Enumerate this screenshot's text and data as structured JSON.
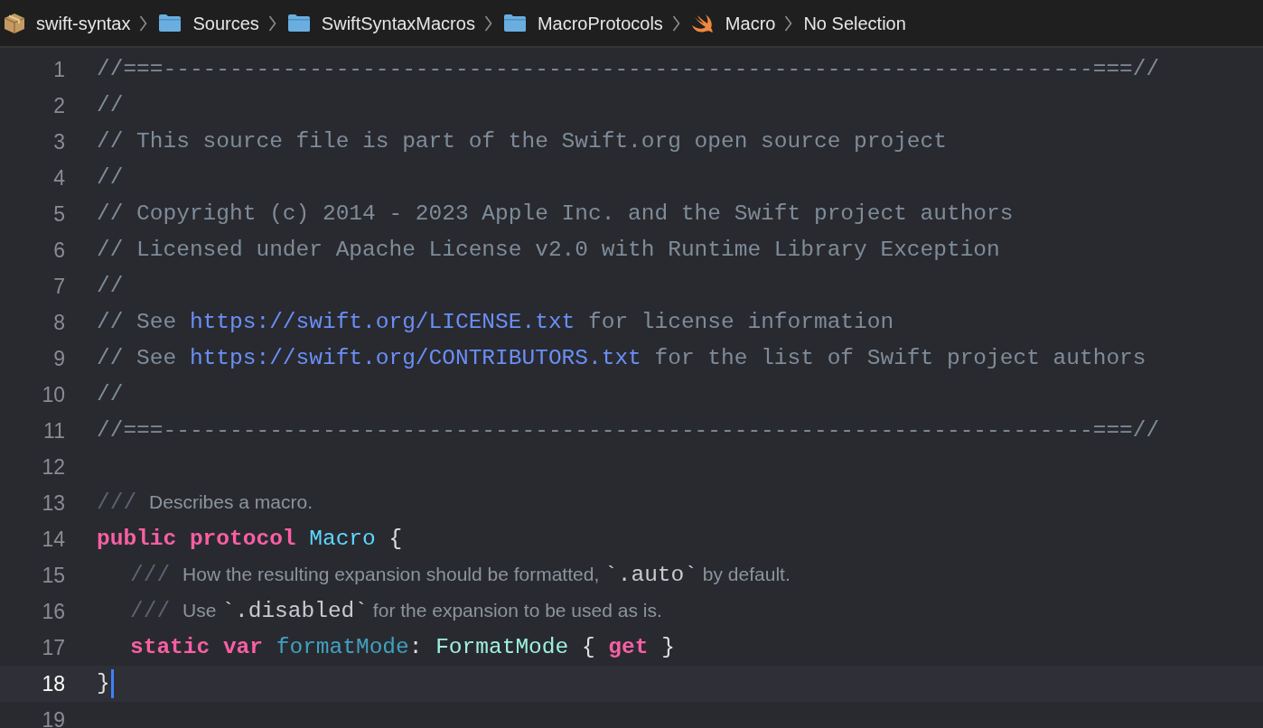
{
  "breadcrumbs": [
    {
      "label": "swift-syntax",
      "kind": "package"
    },
    {
      "label": "Sources",
      "kind": "folder"
    },
    {
      "label": "SwiftSyntaxMacros",
      "kind": "folder"
    },
    {
      "label": "MacroProtocols",
      "kind": "folder"
    },
    {
      "label": "Macro",
      "kind": "swift"
    },
    {
      "label": "No Selection",
      "kind": "plain"
    }
  ],
  "lines": [
    {
      "number": "1",
      "current": false,
      "tokens": [
        {
          "text": "//===----------------------------------------------------------------------===//",
          "kind": "comment"
        }
      ]
    },
    {
      "number": "2",
      "current": false,
      "tokens": [
        {
          "text": "//",
          "kind": "comment"
        }
      ]
    },
    {
      "number": "3",
      "current": false,
      "tokens": [
        {
          "text": "// This source file is part of the Swift.org open source project",
          "kind": "comment"
        }
      ]
    },
    {
      "number": "4",
      "current": false,
      "tokens": [
        {
          "text": "//",
          "kind": "comment"
        }
      ]
    },
    {
      "number": "5",
      "current": false,
      "tokens": [
        {
          "text": "// Copyright (c) 2014 - 2023 Apple Inc. and the Swift project authors",
          "kind": "comment"
        }
      ]
    },
    {
      "number": "6",
      "current": false,
      "tokens": [
        {
          "text": "// Licensed under Apache License v2.0 with Runtime Library Exception",
          "kind": "comment"
        }
      ]
    },
    {
      "number": "7",
      "current": false,
      "tokens": [
        {
          "text": "//",
          "kind": "comment"
        }
      ]
    },
    {
      "number": "8",
      "current": false,
      "tokens": [
        {
          "text": "// See ",
          "kind": "comment"
        },
        {
          "text": "https://swift.org/LICENSE.txt",
          "kind": "url"
        },
        {
          "text": " for license information",
          "kind": "comment"
        }
      ]
    },
    {
      "number": "9",
      "current": false,
      "tokens": [
        {
          "text": "// See ",
          "kind": "comment"
        },
        {
          "text": "https://swift.org/CONTRIBUTORS.txt",
          "kind": "url"
        },
        {
          "text": " for the list of Swift project authors",
          "kind": "comment"
        }
      ]
    },
    {
      "number": "10",
      "current": false,
      "tokens": [
        {
          "text": "//",
          "kind": "comment"
        }
      ]
    },
    {
      "number": "11",
      "current": false,
      "tokens": [
        {
          "text": "//===----------------------------------------------------------------------===//",
          "kind": "comment"
        }
      ]
    },
    {
      "number": "12",
      "current": false
    },
    {
      "number": "13",
      "current": false,
      "tokens": [
        {
          "text": "///",
          "kind": "doc-marker"
        },
        {
          "text": "Describes a macro.",
          "kind": "doc-text"
        }
      ]
    },
    {
      "number": "14",
      "current": false,
      "tokens": [
        {
          "text": "public ",
          "kind": "keyword"
        },
        {
          "text": "protocol ",
          "kind": "keyword"
        },
        {
          "text": "Macro ",
          "kind": "declaration"
        },
        {
          "text": "{",
          "kind": "punct"
        }
      ],
      "children": [
        {
          "number": "15",
          "current": false,
          "tokens": [
            {
              "text": "///",
              "kind": "doc-marker"
            },
            {
              "text": "How the resulting expansion should be formatted, ",
              "kind": "doc-text"
            },
            {
              "text": "`.auto`",
              "kind": "doc-code"
            },
            {
              "text": " by default.",
              "kind": "doc-text"
            }
          ]
        },
        {
          "number": "16",
          "current": false,
          "tokens": [
            {
              "text": "///",
              "kind": "doc-marker"
            },
            {
              "text": "Use ",
              "kind": "doc-text"
            },
            {
              "text": "`.disabled`",
              "kind": "doc-code"
            },
            {
              "text": " for the expansion to be used as is.",
              "kind": "doc-text"
            }
          ]
        },
        {
          "number": "17",
          "current": false,
          "tokens": [
            {
              "text": "static ",
              "kind": "keyword"
            },
            {
              "text": "var ",
              "kind": "keyword"
            },
            {
              "text": "formatMode",
              "kind": "property"
            },
            {
              "text": ": ",
              "kind": "punct"
            },
            {
              "text": "FormatMode ",
              "kind": "type"
            },
            {
              "text": "{ ",
              "kind": "punct"
            },
            {
              "text": "get ",
              "kind": "keyword"
            },
            {
              "text": "}",
              "kind": "punct"
            }
          ]
        }
      ]
    },
    {
      "number": "18",
      "current": true,
      "tokens": [
        {
          "text": "}",
          "kind": "punct"
        }
      ]
    },
    {
      "number": "19",
      "current": false
    }
  ]
}
